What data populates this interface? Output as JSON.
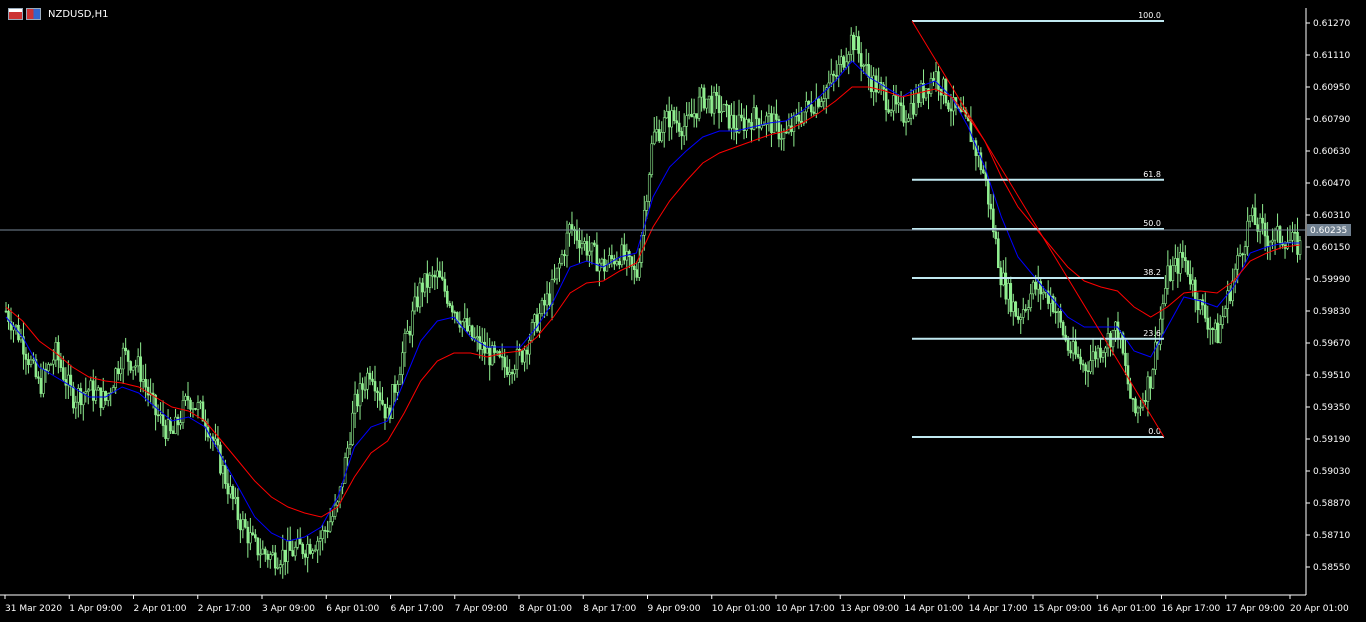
{
  "chart_window": {
    "symbol_label": "NZDUSD,H1",
    "icon_left": "chart-window-icon",
    "icon_right": "symbol-flag-icon",
    "colors": {
      "background": "#000000",
      "candle": "#90ee90",
      "ma_fast": "#0000ff",
      "ma_slow": "#ff0000",
      "fibo": "#c0e8f0",
      "axis": "#ffffff",
      "price_line": "#778899"
    }
  },
  "chart_data": {
    "type": "candlestick",
    "symbol": "NZDUSD",
    "timeframe": "H1",
    "y_ticks": [
      "0.61270",
      "0.61110",
      "0.60950",
      "0.60790",
      "0.60630",
      "0.60470",
      "0.60310",
      "0.60150",
      "0.59990",
      "0.59830",
      "0.59670",
      "0.59510",
      "0.59350",
      "0.59190",
      "0.59030",
      "0.58870",
      "0.58710",
      "0.58550"
    ],
    "ylim": [
      0.5846,
      0.6135
    ],
    "x_ticks": [
      "31 Mar 2020",
      "1 Apr 09:00",
      "2 Apr 01:00",
      "2 Apr 17:00",
      "3 Apr 09:00",
      "6 Apr 01:00",
      "6 Apr 17:00",
      "7 Apr 09:00",
      "8 Apr 01:00",
      "8 Apr 17:00",
      "9 Apr 09:00",
      "10 Apr 01:00",
      "10 Apr 17:00",
      "13 Apr 09:00",
      "14 Apr 01:00",
      "14 Apr 17:00",
      "15 Apr 09:00",
      "16 Apr 01:00",
      "16 Apr 17:00",
      "17 Apr 09:00",
      "20 Apr 01:00"
    ],
    "current_price": "0.60235",
    "current_price_value": 0.60235,
    "fibonacci": {
      "high": 0.6128,
      "low": 0.592,
      "levels": [
        {
          "label": "100.0",
          "price": 0.6128
        },
        {
          "label": "61.8",
          "price": 0.60486
        },
        {
          "label": "50.0",
          "price": 0.6024
        },
        {
          "label": "38.2",
          "price": 0.59995
        },
        {
          "label": "23.6",
          "price": 0.59691
        },
        {
          "label": "0.0",
          "price": 0.592
        }
      ]
    },
    "series": [
      {
        "name": "close_path",
        "values": [
          0.5983,
          0.5968,
          0.5945,
          0.5962,
          0.594,
          0.5944,
          0.5938,
          0.5962,
          0.5955,
          0.5932,
          0.592,
          0.594,
          0.593,
          0.5905,
          0.588,
          0.5865,
          0.586,
          0.5862,
          0.5865,
          0.587,
          0.5885,
          0.5935,
          0.5955,
          0.593,
          0.5965,
          0.5995,
          0.6,
          0.5985,
          0.597,
          0.5962,
          0.5955,
          0.596,
          0.5978,
          0.5995,
          0.6025,
          0.6015,
          0.6005,
          0.6012,
          0.6,
          0.607,
          0.608,
          0.6075,
          0.609,
          0.6085,
          0.6075,
          0.608,
          0.6078,
          0.607,
          0.6082,
          0.609,
          0.61,
          0.612,
          0.61,
          0.609,
          0.608,
          0.609,
          0.6102,
          0.6085,
          0.6075,
          0.605,
          0.6,
          0.598,
          0.5995,
          0.599,
          0.5965,
          0.5955,
          0.5965,
          0.5975,
          0.593,
          0.595,
          0.6,
          0.601,
          0.5985,
          0.597,
          0.6,
          0.603,
          0.602,
          0.602,
          0.6015
        ]
      }
    ],
    "moving_averages": [
      {
        "color": "#0000ff",
        "values": [
          0.598,
          0.597,
          0.5955,
          0.595,
          0.5945,
          0.594,
          0.594,
          0.5945,
          0.5942,
          0.5935,
          0.5928,
          0.593,
          0.5925,
          0.591,
          0.5895,
          0.588,
          0.5872,
          0.5868,
          0.587,
          0.5875,
          0.589,
          0.5915,
          0.5925,
          0.5928,
          0.5948,
          0.5968,
          0.5978,
          0.598,
          0.597,
          0.5965,
          0.5965,
          0.5965,
          0.5975,
          0.5988,
          0.6005,
          0.6008,
          0.6005,
          0.601,
          0.6012,
          0.604,
          0.6055,
          0.6063,
          0.607,
          0.6073,
          0.6073,
          0.6075,
          0.6077,
          0.6078,
          0.6083,
          0.609,
          0.6098,
          0.6108,
          0.61,
          0.6095,
          0.609,
          0.6095,
          0.6098,
          0.609,
          0.6075,
          0.6055,
          0.603,
          0.601,
          0.6,
          0.599,
          0.598,
          0.5975,
          0.5975,
          0.5975,
          0.5963,
          0.596,
          0.5975,
          0.599,
          0.5988,
          0.5985,
          0.5995,
          0.6012,
          0.6015,
          0.6017,
          0.6017
        ]
      },
      {
        "color": "#ff0000",
        "values": [
          0.5985,
          0.5978,
          0.5968,
          0.5962,
          0.5955,
          0.595,
          0.5948,
          0.5947,
          0.5945,
          0.594,
          0.5935,
          0.5933,
          0.5928,
          0.5918,
          0.5908,
          0.5898,
          0.589,
          0.5885,
          0.5882,
          0.588,
          0.5885,
          0.59,
          0.5912,
          0.5918,
          0.5932,
          0.5948,
          0.5958,
          0.5962,
          0.5962,
          0.596,
          0.5962,
          0.5963,
          0.597,
          0.598,
          0.5992,
          0.5997,
          0.5998,
          0.6003,
          0.6007,
          0.6025,
          0.6038,
          0.6048,
          0.6057,
          0.6062,
          0.6065,
          0.6068,
          0.6071,
          0.6073,
          0.6077,
          0.6082,
          0.6088,
          0.6095,
          0.6095,
          0.6093,
          0.609,
          0.6092,
          0.6094,
          0.609,
          0.608,
          0.6068,
          0.605,
          0.6035,
          0.6025,
          0.6015,
          0.6005,
          0.5998,
          0.5995,
          0.5993,
          0.5985,
          0.598,
          0.5985,
          0.5992,
          0.5993,
          0.5992,
          0.5998,
          0.6008,
          0.6012,
          0.6015,
          0.6016
        ]
      }
    ],
    "grid": false,
    "legend": "none",
    "title": "NZDUSD,H1"
  }
}
